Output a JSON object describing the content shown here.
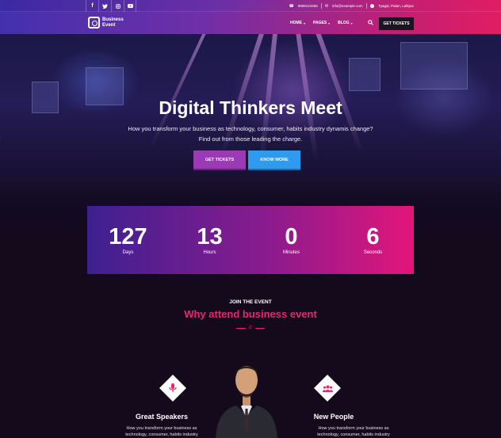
{
  "topbar": {
    "social": [
      "f",
      "t",
      "ig",
      "yt"
    ],
    "phone": "9889123456",
    "email": "info@example.com",
    "address": "Tyagal, Patan, Lalitpur"
  },
  "nav": {
    "logo_line1": "Business",
    "logo_line2": "Event",
    "menu": [
      {
        "label": "HOME"
      },
      {
        "label": "PAGES"
      },
      {
        "label": "BLOG"
      }
    ],
    "cta_label": "GET TICKETS"
  },
  "hero": {
    "title": "Digital Thinkers Meet",
    "subtitle_line1": "How you transform your business as technology, consumer, habits industry dynamis change?",
    "subtitle_line2": "Find out from those leading the charge.",
    "btn_tickets": "GET TICKETS",
    "btn_more": "KNOW MORE"
  },
  "countdown": [
    {
      "value": "127",
      "label": "Days"
    },
    {
      "value": "13",
      "label": "Hours"
    },
    {
      "value": "0",
      "label": "Minutes"
    },
    {
      "value": "6",
      "label": "Seconds"
    }
  ],
  "about": {
    "eyebrow": "JOIN THE EVENT",
    "heading": "Why attend business event"
  },
  "features": [
    {
      "icon": "microphone-icon",
      "title": "Great Speakers",
      "text_line1": "How you transform your business as",
      "text_line2": "technology, consumer, habits industry"
    },
    {
      "icon": "people-icon",
      "title": "New People",
      "text_line1": "How you transform your business as",
      "text_line2": "technology, consumer, habits industry"
    }
  ],
  "colors": {
    "accent_pink": "#e6296d",
    "button_purple": "#9a3ab5",
    "button_blue": "#2f9bf0",
    "dark_bg": "#150a1c"
  }
}
